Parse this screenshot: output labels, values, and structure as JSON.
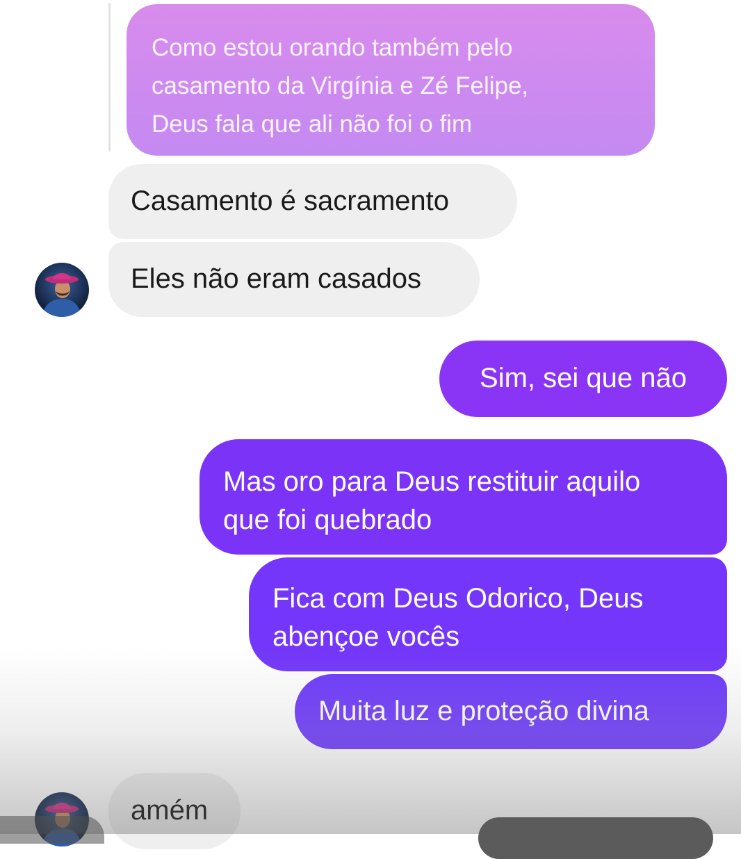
{
  "conversation": {
    "quoted_message": "Como estou orando também pelo\ncasamento da Virgínia e Zé Felipe,\nDeus fala que ali não foi o fim",
    "messages": [
      {
        "side": "incoming",
        "text": "Casamento é sacramento"
      },
      {
        "side": "incoming",
        "text": "Eles não eram casados"
      },
      {
        "side": "outgoing",
        "text": "Sim,  sei que não"
      },
      {
        "side": "outgoing",
        "text": "Mas oro para Deus restituir aquilo\nque foi quebrado"
      },
      {
        "side": "outgoing",
        "text": "Fica com Deus Odorico,  Deus\nabençoe vocês"
      },
      {
        "side": "outgoing",
        "text": "Muita luz e proteção divina"
      },
      {
        "side": "incoming",
        "text": "amém"
      }
    ]
  },
  "colors": {
    "quoted_bubble": "#d88bec",
    "incoming_bubble": "#efefef",
    "outgoing_bubble": "#7b33f8"
  },
  "icons": {
    "contact_avatar": "person-with-pink-cowboy-hat-avatar"
  }
}
